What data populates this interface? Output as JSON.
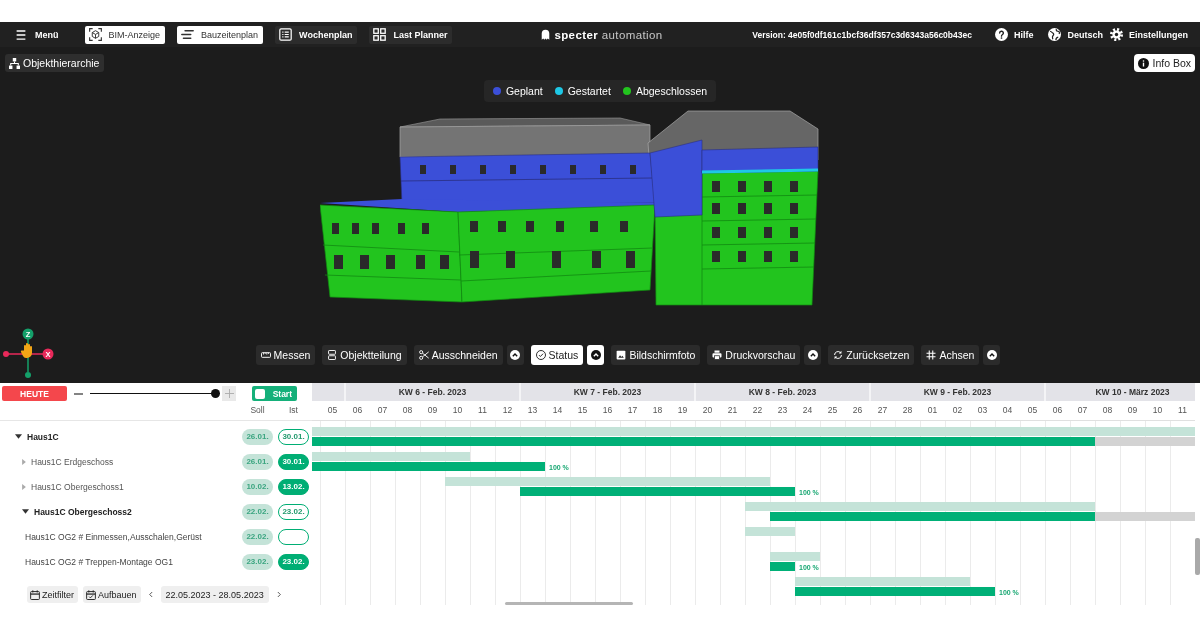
{
  "nav": {
    "menu": "Menü",
    "tabs": [
      {
        "label": "BIM-Anzeige",
        "selected": true
      },
      {
        "label": "Bauzeitenplan",
        "selected": true
      },
      {
        "label": "Wochenplan",
        "selected": false
      },
      {
        "label": "Last Planner",
        "selected": false
      }
    ],
    "logo": "**specter** automation",
    "version": "Version: 4e05f0df161c1bcf36df357c3d6343a56c0b43ec",
    "links": [
      "Hilfe",
      "Deutsch",
      "Einstellungen"
    ]
  },
  "viewer": {
    "hierarchy_button": "Objekthierarchie",
    "info_button": "Info Box",
    "legend": [
      {
        "label": "Geplant",
        "color": "#3b4fd8"
      },
      {
        "label": "Gestartet",
        "color": "#1ec8e6"
      },
      {
        "label": "Abgeschlossen",
        "color": "#22c41e"
      }
    ],
    "axes": [
      {
        "label": "Z",
        "color": "#14a06a"
      },
      {
        "label": "X",
        "color": "#e8295a"
      }
    ],
    "tools": [
      {
        "label": "Messen",
        "selected": false,
        "menu": false
      },
      {
        "label": "Objektteilung",
        "selected": false,
        "menu": false
      },
      {
        "label": "Ausschneiden",
        "selected": false,
        "menu": true
      },
      {
        "label": "Status",
        "selected": true,
        "menu": true
      },
      {
        "label": "Bildschirmfoto",
        "selected": false,
        "menu": false
      },
      {
        "label": "Druckvorschau",
        "selected": false,
        "menu": true
      },
      {
        "label": "Zurücksetzen",
        "selected": false,
        "menu": false
      },
      {
        "label": "Achsen",
        "selected": false,
        "menu": true
      }
    ]
  },
  "gantt": {
    "today_button": "HEUTE",
    "zoom": {
      "level": 1
    },
    "start_toggle": {
      "label": "Start",
      "on": true
    },
    "columns": [
      "Soll",
      "Ist"
    ],
    "tree": [
      {
        "label": "Haus1C",
        "expanded": true,
        "soll": "26.01.",
        "ist": {
          "text": "30.01.",
          "done": false
        },
        "children": [
          {
            "label": "Haus1C Erdgeschoss",
            "expanded": false,
            "soll": "26.01.",
            "ist": {
              "text": "30.01.",
              "done": true
            },
            "progress": "100 %"
          },
          {
            "label": "Haus1C Obergeschoss1",
            "expanded": false,
            "soll": "10.02.",
            "ist": {
              "text": "13.02.",
              "done": true
            },
            "progress": "100 %"
          },
          {
            "label": "Haus1C Obergeschoss2",
            "expanded": true,
            "soll": "22.02.",
            "ist": {
              "text": "23.02.",
              "done": false
            },
            "children": [
              {
                "label": "Haus1C OG2 # Einmessen,Ausschalen,Gerüst",
                "soll": "22.02.",
                "ist": {
                  "done": false
                }
              },
              {
                "label": "Haus1C OG2 # Treppen-Montage OG1",
                "soll": "23.02.",
                "ist": {
                  "text": "23.02.",
                  "done": true
                },
                "progress": "100 %"
              },
              {
                "progress": "100 %"
              }
            ]
          }
        ]
      }
    ],
    "timeline": {
      "weeks": [
        "KW 6 - Feb. 2023",
        "KW 7 - Feb. 2023",
        "KW 8 - Feb. 2023",
        "KW 9 - Feb. 2023",
        "KW 10 - März 2023"
      ],
      "days": [
        "05",
        "06",
        "07",
        "08",
        "09",
        "10",
        "11",
        "12",
        "13",
        "14",
        "15",
        "16",
        "17",
        "18",
        "19",
        "20",
        "21",
        "22",
        "23",
        "24",
        "25",
        "26",
        "27",
        "28",
        "01",
        "02",
        "03",
        "04",
        "05",
        "06",
        "07",
        "08",
        "09",
        "10",
        "11"
      ]
    },
    "footer": {
      "buttons": [
        "Zeitfilter",
        "Aufbauen"
      ],
      "date_range": "22.05.2023 - 28.05.2023"
    }
  }
}
